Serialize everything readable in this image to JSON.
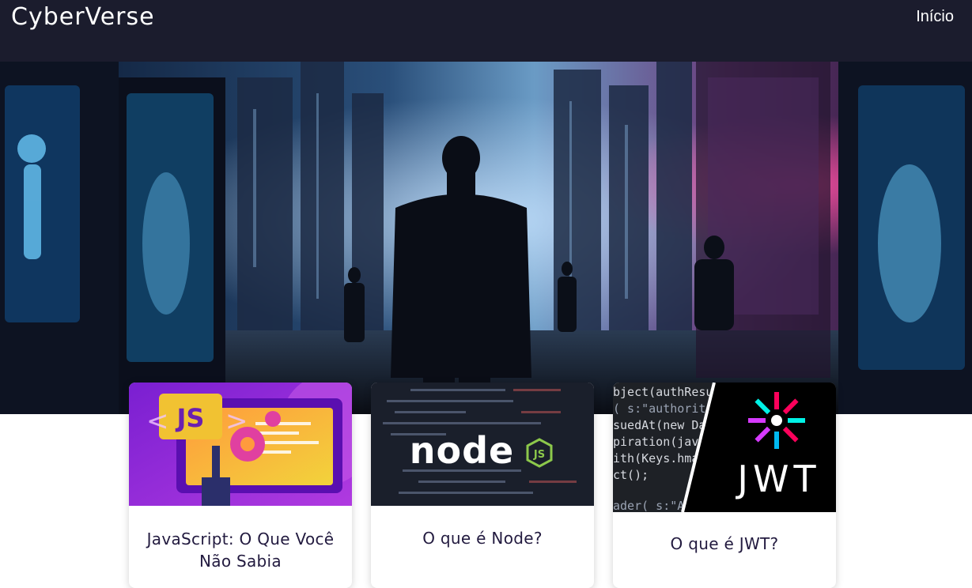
{
  "navbar": {
    "brand": "CyberVerse",
    "links": [
      {
        "label": "Início"
      }
    ]
  },
  "hero": {
    "alt": "cyberpunk-city-scene"
  },
  "posts": [
    {
      "title": "JavaScript: O Que Você Não Sabia",
      "image_text": "JS"
    },
    {
      "title": "O que é Node?",
      "image_text": "node",
      "image_badge": "JS"
    },
    {
      "title": "O que é JWT?",
      "image_text": "JWT",
      "code_lines": [
        "bject(authResu",
        "( s:\"authoriti",
        "suedAt(new Da",
        "piration(java",
        "ith(Keys.hma",
        "ct();",
        "ader( s:\"A"
      ]
    }
  ],
  "colors": {
    "navbar_bg": "#1b1c2d",
    "title_color": "#221a3f",
    "js_purple": "#8a2bd8",
    "node_bg": "#1a1f2b",
    "jwt_bg": "#000000"
  }
}
